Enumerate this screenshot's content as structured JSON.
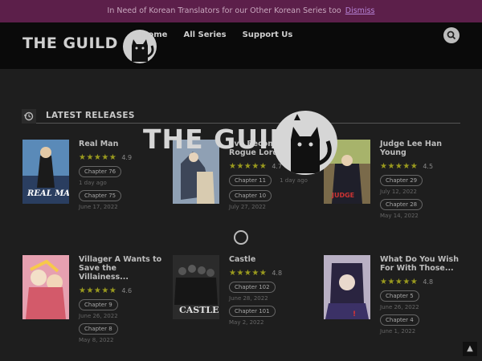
{
  "banner": {
    "text": "In Need of Korean Translators for our Other Korean Series too",
    "dismiss": "Dismiss"
  },
  "header": {
    "logo_text": "THE GUILD",
    "nav": [
      {
        "label": "Home"
      },
      {
        "label": "All Series"
      },
      {
        "label": "Support Us"
      }
    ]
  },
  "section": {
    "title": "LATEST RELEASES"
  },
  "overlay": {
    "logo_text": "THE GUILD"
  },
  "items": [
    {
      "title": "Real Man",
      "rating": "4.9",
      "chapters": [
        {
          "label": "Chapter 76",
          "date": "1 day ago"
        },
        {
          "label": "Chapter 75",
          "date": "June 17, 2022"
        }
      ],
      "cover_text": "REAL MAN"
    },
    {
      "title": "I've Become a Rogue Lord in a",
      "rating": "4.7",
      "chapters": [
        {
          "label": "Chapter 11",
          "date": "1 day ago"
        },
        {
          "label": "Chapter 10",
          "date": "July 27, 2022"
        }
      ],
      "cover_text": ""
    },
    {
      "title": "Judge Lee Han Young",
      "rating": "4.5",
      "chapters": [
        {
          "label": "Chapter 29",
          "date": "July 12, 2022"
        },
        {
          "label": "Chapter 28",
          "date": "May 14, 2022"
        }
      ],
      "cover_text": "JUDGE"
    },
    {
      "title": "Villager A Wants to Save the Villainess...",
      "rating": "4.6",
      "chapters": [
        {
          "label": "Chapter 9",
          "date": "June 26, 2022"
        },
        {
          "label": "Chapter 8",
          "date": "May 8, 2022"
        }
      ],
      "cover_text": ""
    },
    {
      "title": "Castle",
      "rating": "4.8",
      "chapters": [
        {
          "label": "Chapter 102",
          "date": "June 28, 2022"
        },
        {
          "label": "Chapter 101",
          "date": "May 2, 2022"
        }
      ],
      "cover_text": "CASTLE"
    },
    {
      "title": "What Do You Wish For With Those...",
      "rating": "4.8",
      "chapters": [
        {
          "label": "Chapter 5",
          "date": "June 26, 2022"
        },
        {
          "label": "Chapter 4",
          "date": "June 1, 2022"
        }
      ],
      "cover_text": ""
    }
  ],
  "colors": {
    "banner_bg": "#5c1f4a",
    "star": "#9a9a1e",
    "page_bg": "#1e1e1e"
  },
  "icons": {
    "search": "search-icon",
    "history": "history-icon",
    "back_to_top": "arrow-up-icon",
    "loading": "loading-spinner"
  }
}
